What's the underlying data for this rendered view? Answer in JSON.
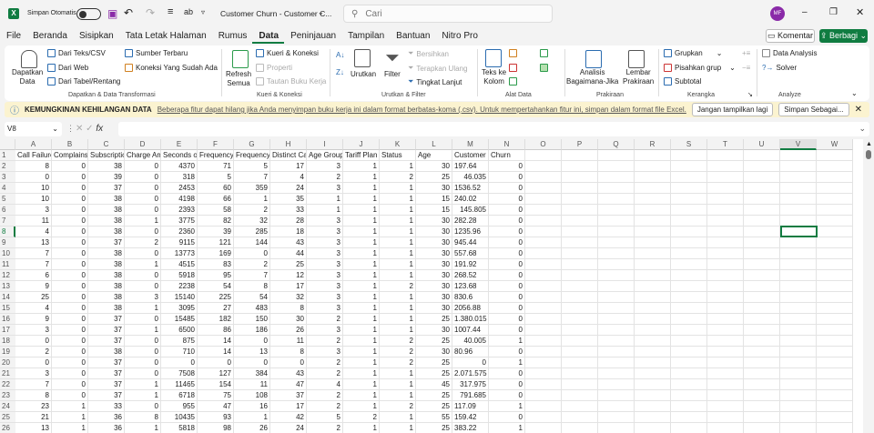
{
  "titlebar": {
    "autosave": "Simpan Otomatis",
    "doc_title": "Customer Churn - Customer C...",
    "search_placeholder": "Cari",
    "avatar": "MF"
  },
  "menu": [
    "File",
    "Beranda",
    "Sisipkan",
    "Tata Letak Halaman",
    "Rumus",
    "Data",
    "Peninjauan",
    "Tampilan",
    "Bantuan",
    "Nitro Pro"
  ],
  "actions": {
    "komentar": "Komentar",
    "berbagi": "Berbagi"
  },
  "ribbon": {
    "get_data": "Dapatkan",
    "get_data2": "Data",
    "from_text": "Dari Teks/CSV",
    "from_web": "Dari Web",
    "from_table": "Dari Tabel/Rentang",
    "recent": "Sumber Terbaru",
    "existing": "Koneksi Yang Sudah Ada",
    "g1": "Dapatkan & Data Transformasi",
    "refresh": "Refresh",
    "refresh2": "Semua",
    "queries": "Kueri & Koneksi",
    "properties": "Properti",
    "links": "Tautan Buku Kerja",
    "g2": "Kueri & Koneksi",
    "sort": "Urutkan",
    "filter": "Filter",
    "clear": "Bersihkan",
    "reapply": "Terapkan Ulang",
    "advanced": "Tingkat Lanjut",
    "g3": "Urutkan & Filter",
    "t2c": "Teks ke",
    "t2c2": "Kolom",
    "g4": "Alat Data",
    "whatif": "Analisis",
    "whatif2": "Bagaimana-Jika",
    "forecast": "Lembar",
    "forecast2": "Prakiraan",
    "g5": "Prakiraan",
    "group": "Grupkan",
    "ungroup": "Pisahkan grup",
    "subtotal": "Subtotal",
    "g6": "Kerangka",
    "data_analysis": "Data Analysis",
    "solver": "Solver",
    "g7": "Analyze"
  },
  "infobar": {
    "title": "KEMUNGKINAN KEHILANGAN DATA",
    "message": "Beberapa fitur dapat hilang jika Anda menyimpan buku kerja ini dalam format berbatas-koma (.csv). Untuk mempertahankan fitur ini, simpan dalam format file Excel.",
    "dont_show": "Jangan tampilkan lagi",
    "save_as": "Simpan Sebagai..."
  },
  "formula": {
    "namebox": "V8",
    "value": ""
  },
  "columns": [
    "A",
    "B",
    "C",
    "D",
    "E",
    "F",
    "G",
    "H",
    "I",
    "J",
    "K",
    "L",
    "M",
    "N",
    "O",
    "P",
    "Q",
    "R",
    "S",
    "T",
    "U",
    "V",
    "W"
  ],
  "headers": [
    "Call  Failure",
    "Complains",
    "Subscription",
    "Charge  Amount",
    "Seconds of Use",
    "Frequency",
    "Frequency",
    "Distinct Ca",
    "Age Group",
    "Tariff Plan",
    "Status",
    "Age",
    "Customer",
    "Churn"
  ],
  "rows": [
    [
      8,
      0,
      38,
      0,
      4370,
      71,
      5,
      17,
      3,
      1,
      1,
      30,
      "197.64",
      0
    ],
    [
      0,
      0,
      39,
      0,
      318,
      5,
      7,
      4,
      2,
      1,
      2,
      25,
      46.035,
      0
    ],
    [
      10,
      0,
      37,
      0,
      2453,
      60,
      359,
      24,
      3,
      1,
      1,
      30,
      "1536.52",
      0
    ],
    [
      10,
      0,
      38,
      0,
      4198,
      66,
      1,
      35,
      1,
      1,
      1,
      15,
      "240.02",
      0
    ],
    [
      3,
      0,
      38,
      0,
      2393,
      58,
      2,
      33,
      1,
      1,
      1,
      15,
      145.805,
      0
    ],
    [
      11,
      0,
      38,
      1,
      3775,
      82,
      32,
      28,
      3,
      1,
      1,
      30,
      "282.28",
      0
    ],
    [
      4,
      0,
      38,
      0,
      2360,
      39,
      285,
      18,
      3,
      1,
      1,
      30,
      "1235.96",
      0
    ],
    [
      13,
      0,
      37,
      2,
      9115,
      121,
      144,
      43,
      3,
      1,
      1,
      30,
      "945.44",
      0
    ],
    [
      7,
      0,
      38,
      0,
      13773,
      169,
      0,
      44,
      3,
      1,
      1,
      30,
      "557.68",
      0
    ],
    [
      7,
      0,
      38,
      1,
      4515,
      83,
      2,
      25,
      3,
      1,
      1,
      30,
      "191.92",
      0
    ],
    [
      6,
      0,
      38,
      0,
      5918,
      95,
      7,
      12,
      3,
      1,
      1,
      30,
      "268.52",
      0
    ],
    [
      9,
      0,
      38,
      0,
      2238,
      54,
      8,
      17,
      3,
      1,
      2,
      30,
      "123.68",
      0
    ],
    [
      25,
      0,
      38,
      3,
      15140,
      225,
      54,
      32,
      3,
      1,
      1,
      30,
      "830.6",
      0
    ],
    [
      4,
      0,
      38,
      1,
      3095,
      27,
      483,
      8,
      3,
      1,
      1,
      30,
      "2056.88",
      0
    ],
    [
      9,
      0,
      37,
      0,
      15485,
      182,
      150,
      30,
      2,
      1,
      1,
      25,
      "1.380.015",
      0
    ],
    [
      3,
      0,
      37,
      1,
      6500,
      86,
      186,
      26,
      3,
      1,
      1,
      30,
      "1007.44",
      0
    ],
    [
      0,
      0,
      37,
      0,
      875,
      14,
      0,
      11,
      2,
      1,
      2,
      25,
      40.005,
      1
    ],
    [
      2,
      0,
      38,
      0,
      710,
      14,
      13,
      8,
      3,
      1,
      2,
      30,
      "80.96",
      0
    ],
    [
      0,
      0,
      37,
      0,
      0,
      0,
      0,
      0,
      2,
      1,
      2,
      25,
      0,
      1
    ],
    [
      3,
      0,
      37,
      0,
      7508,
      127,
      384,
      43,
      2,
      1,
      1,
      25,
      "2.071.575",
      0
    ],
    [
      7,
      0,
      37,
      1,
      11465,
      154,
      11,
      47,
      4,
      1,
      1,
      45,
      317.975,
      0
    ],
    [
      8,
      0,
      37,
      1,
      6718,
      75,
      108,
      37,
      2,
      1,
      1,
      25,
      791.685,
      0
    ],
    [
      23,
      1,
      33,
      0,
      955,
      47,
      16,
      17,
      2,
      1,
      2,
      25,
      "117.09",
      1
    ],
    [
      21,
      1,
      36,
      8,
      10435,
      93,
      1,
      42,
      5,
      2,
      1,
      55,
      "159.42",
      0
    ],
    [
      13,
      1,
      36,
      1,
      5818,
      98,
      26,
      24,
      2,
      1,
      1,
      25,
      "383.22",
      1
    ]
  ]
}
